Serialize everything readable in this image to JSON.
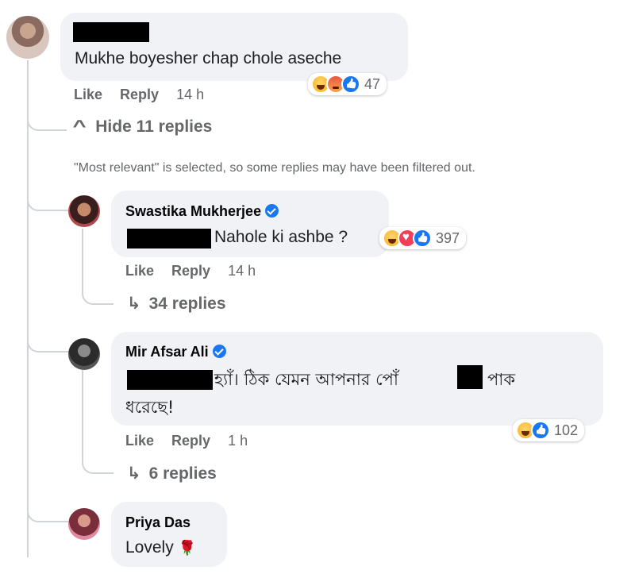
{
  "top_comment": {
    "text": "Mukhe boyesher chap chole aseche",
    "reactions": [
      "haha",
      "angry",
      "like"
    ],
    "count": "47",
    "actions": {
      "like": "Like",
      "reply": "Reply",
      "time": "14 h"
    }
  },
  "hide_replies": {
    "arrow": "^",
    "label": "Hide 11 replies"
  },
  "filter_notice": "\"Most relevant\" is selected, so some replies may have been filtered out.",
  "replies": [
    {
      "name": "Swastika Mukherjee",
      "verified": true,
      "text": "Nahole ki ashbe ?",
      "reactions": [
        "haha",
        "love",
        "like"
      ],
      "count": "397",
      "actions": {
        "like": "Like",
        "reply": "Reply",
        "time": "14 h"
      },
      "more_replies": {
        "arrow": "↳",
        "label": "34 replies"
      }
    },
    {
      "name": "Mir Afsar Ali",
      "verified": true,
      "text_line1_a": "হ্যাঁ। ঠিক যেমন আপনার পোঁ",
      "text_line1_b": "পাক",
      "text_line2": "ধরেছে!",
      "reactions": [
        "haha",
        "like"
      ],
      "count": "102",
      "actions": {
        "like": "Like",
        "reply": "Reply",
        "time": "1 h"
      },
      "more_replies": {
        "arrow": "↳",
        "label": "6 replies"
      }
    },
    {
      "name": "Priya Das",
      "verified": false,
      "text": "Lovely",
      "emoji": "🌹"
    }
  ]
}
